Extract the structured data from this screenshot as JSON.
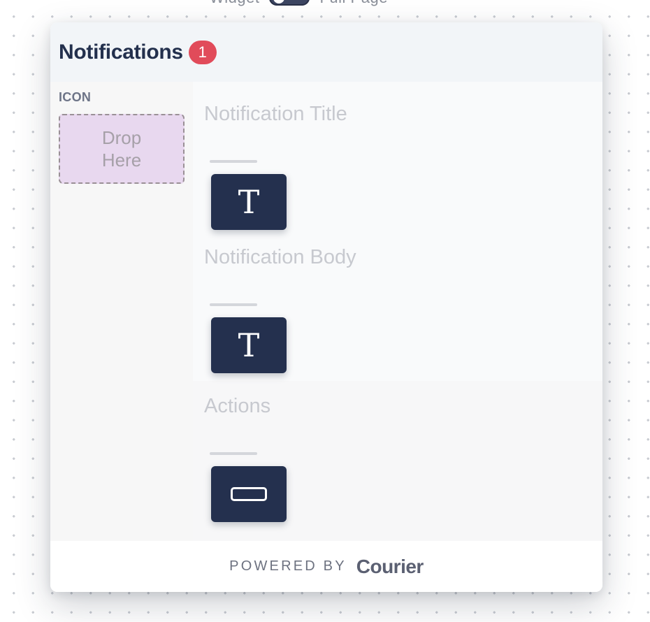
{
  "top_bar": {
    "left_label": "Widget",
    "right_label": "Full Page"
  },
  "header": {
    "title": "Notifications",
    "badge_count": "1"
  },
  "icon_column": {
    "label": "ICON",
    "drop_text": "Drop Here"
  },
  "sections": [
    {
      "title": "Notification Title",
      "block_glyph": "T"
    },
    {
      "title": "Notification Body",
      "block_glyph": "T"
    },
    {
      "title": "Actions"
    }
  ],
  "footer": {
    "powered_by": "POWERED BY",
    "brand": "Courier"
  },
  "colors": {
    "header_bg": "#f2f5f8",
    "title": "#23304d",
    "badge": "#e14b5a",
    "block": "#24304e",
    "drop_zone": "#e8d8ef"
  }
}
